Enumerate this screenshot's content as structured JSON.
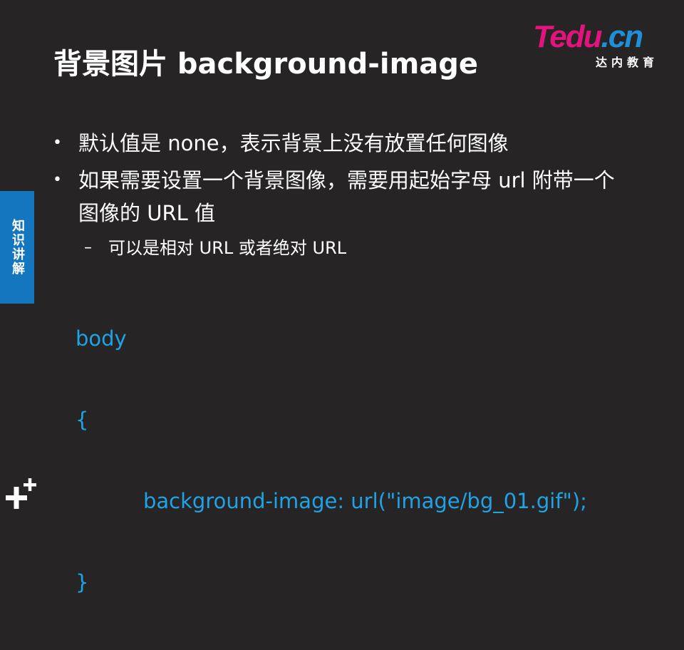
{
  "slide": {
    "title": "背景图片 background-image",
    "logo": {
      "brand_t": "T",
      "brand_edu": "edu",
      "brand_dot": ".",
      "brand_cn": "cn",
      "subtitle": "达内教育"
    },
    "side_tab": "知识讲解",
    "bullets": [
      {
        "text": "默认值是 none，表示背景上没有放置任何图像"
      },
      {
        "text": "如果需要设置一个背景图像，需要用起始字母 url 附带一个图像的 URL 值"
      }
    ],
    "sub_bullets": [
      {
        "text": "可以是相对 URL 或者绝对 URL"
      }
    ],
    "code_lines": [
      "body",
      "{",
      "background-image: url(\"image/bg_01.gif\");",
      "}"
    ],
    "colors": {
      "background": "#262425",
      "code": "#1ea4e4",
      "side_tab": "#1576c0",
      "logo_pink": "#e0147a",
      "logo_blue": "#1e8fd8"
    },
    "icons": {
      "bullet": "•",
      "sub_bullet": "–",
      "corner": "plus-plus-icon"
    }
  }
}
